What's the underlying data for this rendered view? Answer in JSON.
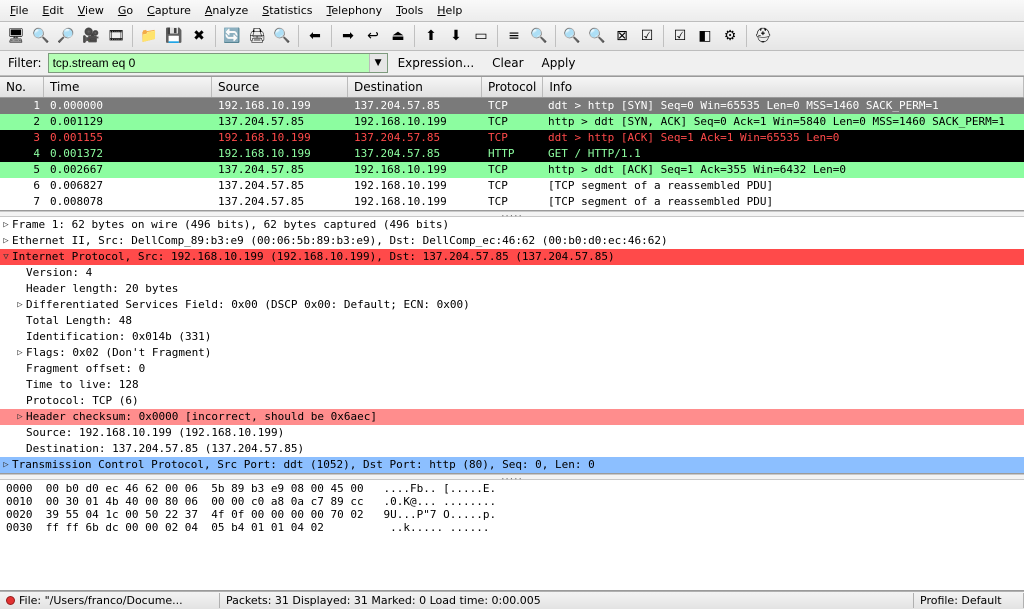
{
  "menu": {
    "items": [
      {
        "hotkey": "F",
        "label": "ile"
      },
      {
        "hotkey": "E",
        "label": "dit"
      },
      {
        "hotkey": "V",
        "label": "iew"
      },
      {
        "hotkey": "G",
        "label": "o"
      },
      {
        "hotkey": "C",
        "label": "apture"
      },
      {
        "hotkey": "A",
        "label": "nalyze"
      },
      {
        "hotkey": "S",
        "label": "tatistics"
      },
      {
        "hotkey": "T",
        "label": "elephony"
      },
      {
        "hotkey": "T",
        "label": "ools"
      },
      {
        "hotkey": "H",
        "label": "elp"
      }
    ]
  },
  "toolbar": {
    "icons": [
      "🖥",
      "🔍",
      "🔎",
      "🎥",
      "🎞",
      "📁",
      "💾",
      "✖",
      "🔄",
      "🖨",
      "🔍",
      "⬅",
      "➡",
      "↩",
      "⏏",
      "⬆",
      "⬇",
      "▭",
      "≡",
      "🔍",
      "🔍",
      "🔍",
      "⊠",
      "☑",
      "☑",
      "◧",
      "⚙",
      "⛑"
    ]
  },
  "filter": {
    "label": "Filter:",
    "value": "tcp.stream eq 0",
    "expression": "Expression...",
    "clear": "Clear",
    "apply": "Apply",
    "dropdown": "▼"
  },
  "columns": {
    "no": "No.",
    "time": "Time",
    "source": "Source",
    "destination": "Destination",
    "protocol": "Protocol",
    "info": "Info"
  },
  "packets": [
    {
      "no": "1",
      "time": "0.000000",
      "src": "192.168.10.199",
      "dst": "137.204.57.85",
      "proto": "TCP",
      "info": "ddt > http [SYN] Seq=0 Win=65535 Len=0 MSS=1460 SACK_PERM=1",
      "variant": "row-sel-gray"
    },
    {
      "no": "2",
      "time": "0.001129",
      "src": "137.204.57.85",
      "dst": "192.168.10.199",
      "proto": "TCP",
      "info": "http > ddt [SYN, ACK] Seq=0 Ack=1 Win=5840 Len=0 MSS=1460 SACK_PERM=1",
      "variant": "row-green"
    },
    {
      "no": "3",
      "time": "0.001155",
      "src": "192.168.10.199",
      "dst": "137.204.57.85",
      "proto": "TCP",
      "info": "ddt > http [ACK] Seq=1 Ack=1 Win=65535 Len=0",
      "variant": "row-black-red"
    },
    {
      "no": "4",
      "time": "0.001372",
      "src": "192.168.10.199",
      "dst": "137.204.57.85",
      "proto": "HTTP",
      "info": "GET / HTTP/1.1",
      "variant": "row-black-green"
    },
    {
      "no": "5",
      "time": "0.002667",
      "src": "137.204.57.85",
      "dst": "192.168.10.199",
      "proto": "TCP",
      "info": "http > ddt [ACK] Seq=1 Ack=355 Win=6432 Len=0",
      "variant": "row-green"
    },
    {
      "no": "6",
      "time": "0.006827",
      "src": "137.204.57.85",
      "dst": "192.168.10.199",
      "proto": "TCP",
      "info": "[TCP segment of a reassembled PDU]",
      "variant": "row-white"
    },
    {
      "no": "7",
      "time": "0.008078",
      "src": "137.204.57.85",
      "dst": "192.168.10.199",
      "proto": "TCP",
      "info": "[TCP segment of a reassembled PDU]",
      "variant": "row-white"
    }
  ],
  "tree": [
    {
      "depth": 0,
      "twisty": "▷",
      "text": "Frame 1: 62 bytes on wire (496 bits), 62 bytes captured (496 bits)",
      "variant": ""
    },
    {
      "depth": 0,
      "twisty": "▷",
      "text": "Ethernet II, Src: DellComp_89:b3:e9 (00:06:5b:89:b3:e9), Dst: DellComp_ec:46:62 (00:b0:d0:ec:46:62)",
      "variant": ""
    },
    {
      "depth": 0,
      "twisty": "▽",
      "text": "Internet Protocol, Src: 192.168.10.199 (192.168.10.199), Dst: 137.204.57.85 (137.204.57.85)",
      "variant": "hl-red-sel"
    },
    {
      "depth": 1,
      "twisty": "",
      "text": "Version: 4",
      "variant": ""
    },
    {
      "depth": 1,
      "twisty": "",
      "text": "Header length: 20 bytes",
      "variant": ""
    },
    {
      "depth": 1,
      "twisty": "▷",
      "text": "Differentiated Services Field: 0x00 (DSCP 0x00: Default; ECN: 0x00)",
      "variant": ""
    },
    {
      "depth": 1,
      "twisty": "",
      "text": "Total Length: 48",
      "variant": ""
    },
    {
      "depth": 1,
      "twisty": "",
      "text": "Identification: 0x014b (331)",
      "variant": ""
    },
    {
      "depth": 1,
      "twisty": "▷",
      "text": "Flags: 0x02 (Don't Fragment)",
      "variant": ""
    },
    {
      "depth": 1,
      "twisty": "",
      "text": "Fragment offset: 0",
      "variant": ""
    },
    {
      "depth": 1,
      "twisty": "",
      "text": "Time to live: 128",
      "variant": ""
    },
    {
      "depth": 1,
      "twisty": "",
      "text": "Protocol: TCP (6)",
      "variant": ""
    },
    {
      "depth": 1,
      "twisty": "▷",
      "text": "Header checksum: 0x0000 [incorrect, should be 0x6aec]",
      "variant": "hl-red"
    },
    {
      "depth": 1,
      "twisty": "",
      "text": "Source: 192.168.10.199 (192.168.10.199)",
      "variant": ""
    },
    {
      "depth": 1,
      "twisty": "",
      "text": "Destination: 137.204.57.85 (137.204.57.85)",
      "variant": ""
    },
    {
      "depth": 0,
      "twisty": "▷",
      "text": "Transmission Control Protocol, Src Port: ddt (1052), Dst Port: http (80), Seq: 0, Len: 0",
      "variant": "hl-blue"
    }
  ],
  "hex": [
    "0000  00 b0 d0 ec 46 62 00 06  5b 89 b3 e9 08 00 45 00   ....Fb.. [.....E.",
    "0010  00 30 01 4b 40 00 80 06  00 00 c0 a8 0a c7 89 cc   .0.K@... ........",
    "0020  39 55 04 1c 00 50 22 37  4f 0f 00 00 00 00 70 02   9U...P\"7 O.....p.",
    "0030  ff ff 6b dc 00 00 02 04  05 b4 01 01 04 02          ..k..... ......"
  ],
  "status": {
    "file": "File: \"/Users/franco/Docume...",
    "packets": "Packets: 31 Displayed: 31 Marked: 0 Load time: 0:00.005",
    "profile": "Profile: Default"
  }
}
